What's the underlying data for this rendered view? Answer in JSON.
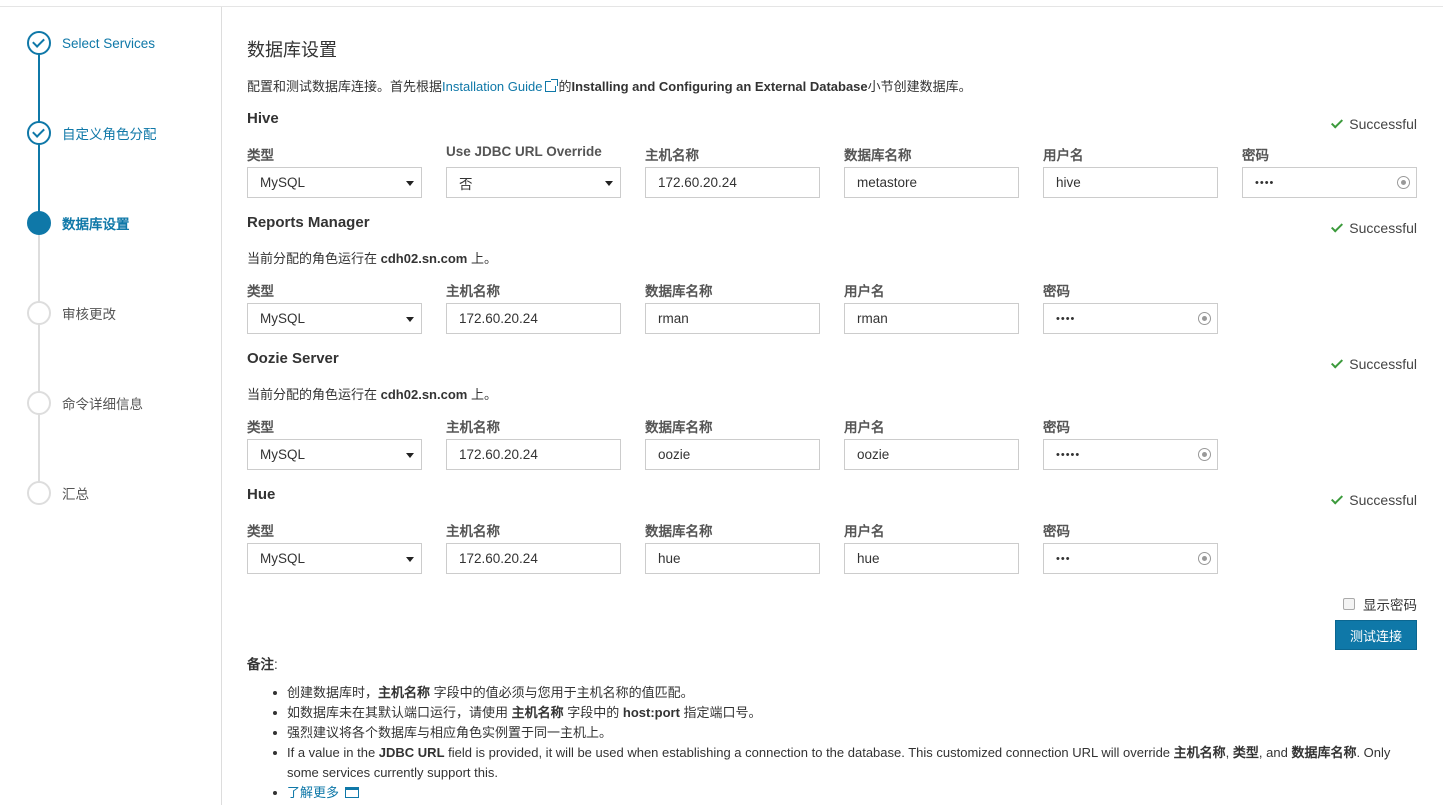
{
  "sidebar": {
    "steps": [
      {
        "label": "Select Services",
        "state": "done"
      },
      {
        "label": "自定义角色分配",
        "state": "done"
      },
      {
        "label": "数据库设置",
        "state": "active"
      },
      {
        "label": "审核更改",
        "state": "todo"
      },
      {
        "label": "命令详细信息",
        "state": "todo"
      },
      {
        "label": "汇总",
        "state": "todo"
      }
    ]
  },
  "page": {
    "title": "数据库设置",
    "intro_prefix": "配置和测试数据库连接。首先根据",
    "intro_link": "Installation Guide",
    "intro_mid": "的",
    "intro_bold": "Installing and Configuring an External Database",
    "intro_suffix": "小节创建数据库。"
  },
  "labels": {
    "type": "类型",
    "jdbc_override": "Use JDBC URL Override",
    "host": "主机名称",
    "db_name": "数据库名称",
    "username": "用户名",
    "password": "密码",
    "assign_prefix": "当前分配的角色运行在",
    "assign_suffix": "上。"
  },
  "status_text": "Successful",
  "colors": {
    "accent": "#0f78a8",
    "success": "#3c9a3c"
  },
  "hive": {
    "title": "Hive",
    "type": "MySQL",
    "jdbc_override": "否",
    "host": "172.60.20.24",
    "db_name": "metastore",
    "username": "hive",
    "password_mask": "••••"
  },
  "reports": {
    "title": "Reports Manager",
    "assign_host": "cdh02.sn.com",
    "type": "MySQL",
    "host": "172.60.20.24",
    "db_name": "rman",
    "username": "rman",
    "password_mask": "••••"
  },
  "oozie": {
    "title": "Oozie Server",
    "assign_host": "cdh02.sn.com",
    "type": "MySQL",
    "host": "172.60.20.24",
    "db_name": "oozie",
    "username": "oozie",
    "password_mask": "•••••"
  },
  "hue": {
    "title": "Hue",
    "type": "MySQL",
    "host": "172.60.20.24",
    "db_name": "hue",
    "username": "hue",
    "password_mask": "•••"
  },
  "show_password": "显示密码",
  "test_button": "测试连接",
  "notes": {
    "title": "备注",
    "colon": ":",
    "n1_prefix": "创建数据库时，",
    "n1_bold": "主机名称",
    "n1_suffix": " 字段中的值必须与您用于主机名称的值匹配。",
    "n2_prefix": "如数据库未在其默认端口运行，请使用 ",
    "n2_bold1": "主机名称",
    "n2_mid": " 字段中的 ",
    "n2_bold2": "host:port",
    "n2_suffix": " 指定端口号。",
    "n3": "强烈建议将各个数据库与相应角色实例置于同一主机上。",
    "n4_prefix": "If a value in the ",
    "n4_bold1": "JDBC URL",
    "n4_mid1": " field is provided, it will be used when establishing a connection to the database. This customized connection URL will override ",
    "n4_bold2": "主机名称",
    "n4_comma": ", ",
    "n4_bold3": "类型",
    "n4_and": ", and ",
    "n4_bold4": "数据库名称",
    "n4_suffix": ". Only some services currently support this.",
    "learn_more": "了解更多"
  }
}
